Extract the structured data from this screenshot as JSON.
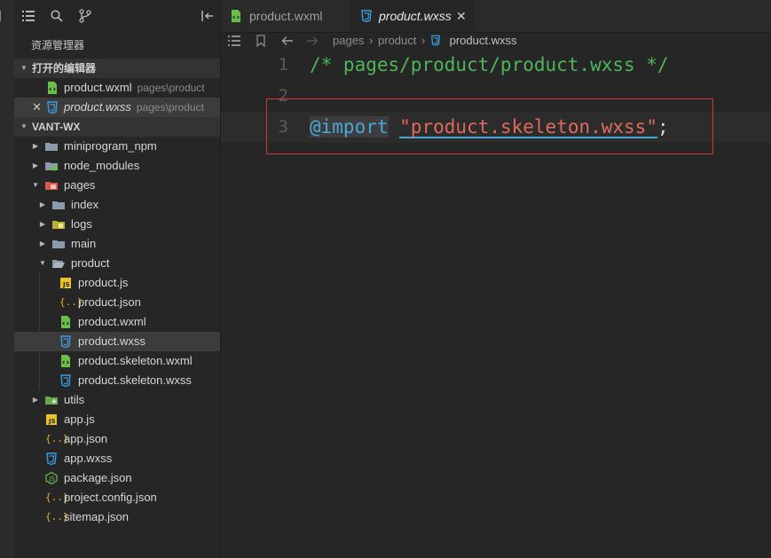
{
  "sidebar": {
    "title": "资源管理器",
    "open_editors": {
      "label": "打开的编辑器",
      "items": [
        {
          "name": "product.wxml",
          "path": "pages\\product"
        },
        {
          "name": "product.wxss",
          "path": "pages\\product"
        }
      ]
    },
    "project": {
      "label": "VANT-WX",
      "tree": [
        {
          "name": "miniprogram_npm"
        },
        {
          "name": "node_modules"
        },
        {
          "name": "pages"
        },
        {
          "name": "index"
        },
        {
          "name": "logs"
        },
        {
          "name": "main"
        },
        {
          "name": "product"
        },
        {
          "name": "product.js"
        },
        {
          "name": "product.json"
        },
        {
          "name": "product.wxml"
        },
        {
          "name": "product.wxss"
        },
        {
          "name": "product.skeleton.wxml"
        },
        {
          "name": "product.skeleton.wxss"
        },
        {
          "name": "utils"
        },
        {
          "name": "app.js"
        },
        {
          "name": "app.json"
        },
        {
          "name": "app.wxss"
        },
        {
          "name": "package.json"
        },
        {
          "name": "project.config.json"
        },
        {
          "name": "sitemap.json"
        }
      ]
    }
  },
  "tabs": [
    {
      "label": "product.wxml"
    },
    {
      "label": "product.wxss",
      "close": "✕"
    }
  ],
  "breadcrumb": [
    "pages",
    "product",
    "product.wxss"
  ],
  "code": {
    "line_numbers": [
      "1",
      "2",
      "3"
    ],
    "line1": "/* pages/product/product.wxss */",
    "line3_keyword": "@import",
    "line3_string": "\"product.skeleton.wxss\"",
    "line3_semicolon": ";"
  },
  "colors": {
    "comment": "#4fb55a",
    "keyword": "#4aa7d8",
    "string": "#e06a5c",
    "highlight_box": "#d13a3a",
    "wxml_icon": "#6abf4b",
    "wxss_icon": "#3d9be0",
    "js_icon": "#e8c32b",
    "json_icon": "#e8b02b",
    "folder": "#8a9bab"
  }
}
